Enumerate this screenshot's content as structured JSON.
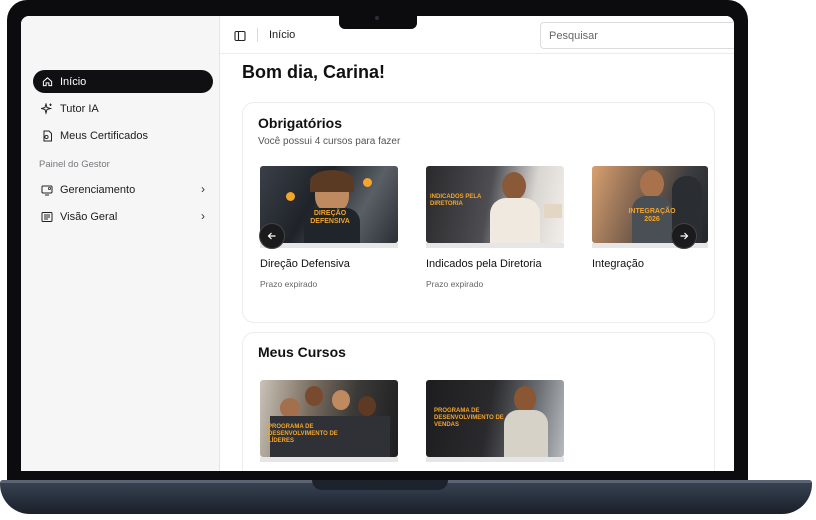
{
  "topbar": {
    "breadcrumb": "Início",
    "search_placeholder": "Pesquisar"
  },
  "sidebar": {
    "items": [
      {
        "label": "Início",
        "icon": "home-icon",
        "active": true
      },
      {
        "label": "Tutor IA",
        "icon": "sparkles-icon"
      },
      {
        "label": "Meus Certificados",
        "icon": "certificate-icon"
      }
    ],
    "section_label": "Painel do Gestor",
    "manager_items": [
      {
        "label": "Gerenciamento",
        "icon": "monitor-settings-icon"
      },
      {
        "label": "Visão Geral",
        "icon": "newspaper-icon"
      }
    ]
  },
  "main": {
    "greeting": "Bom dia, Carina!",
    "required": {
      "title": "Obrigatórios",
      "subtitle": "Você possui 4 cursos para fazer",
      "courses": [
        {
          "title": "Direção Defensiva",
          "status": "Prazo expirado",
          "thumb_text": "Direção Defensiva"
        },
        {
          "title": "Indicados pela Diretoria",
          "status": "Prazo expirado",
          "thumb_text": "Indicados pela Diretoria"
        },
        {
          "title": "Integração",
          "status": "",
          "thumb_text": "Integração 2026"
        }
      ]
    },
    "my_courses": {
      "title": "Meus Cursos",
      "courses": [
        {
          "thumb_text": "Programa de Desenvolvimento de Líderes"
        },
        {
          "thumb_text": "Programa de Desenvolvimento de Vendas"
        }
      ]
    }
  },
  "colors": {
    "accent_orange": "#f4a52a",
    "sidebar_active": "#101012",
    "laptop_frame": "#0c0c0e",
    "laptop_base": "#2a3240"
  }
}
